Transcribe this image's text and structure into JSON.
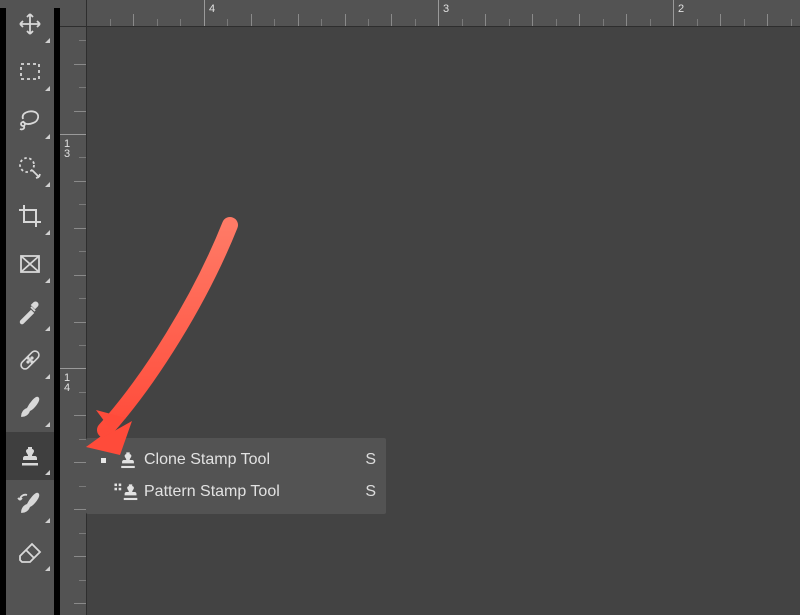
{
  "ruler": {
    "h_majors": [
      "4",
      "3",
      "2"
    ],
    "v_majors": [
      "13",
      "14"
    ]
  },
  "tools": [
    {
      "name": "move",
      "flyout": true
    },
    {
      "name": "rectangular-marquee",
      "flyout": true
    },
    {
      "name": "lasso",
      "flyout": true
    },
    {
      "name": "quick-selection",
      "flyout": true
    },
    {
      "name": "crop",
      "flyout": true
    },
    {
      "name": "frame",
      "flyout": true
    },
    {
      "name": "eyedropper",
      "flyout": true
    },
    {
      "name": "spot-healing-brush",
      "flyout": true
    },
    {
      "name": "brush",
      "flyout": true
    },
    {
      "name": "clone-stamp",
      "flyout": true,
      "selected": true
    },
    {
      "name": "history-brush",
      "flyout": true
    },
    {
      "name": "eraser",
      "flyout": true
    }
  ],
  "flyout": {
    "items": [
      {
        "active": true,
        "label": "Clone Stamp Tool",
        "key": "S"
      },
      {
        "active": false,
        "label": "Pattern Stamp Tool",
        "key": "S"
      }
    ]
  }
}
